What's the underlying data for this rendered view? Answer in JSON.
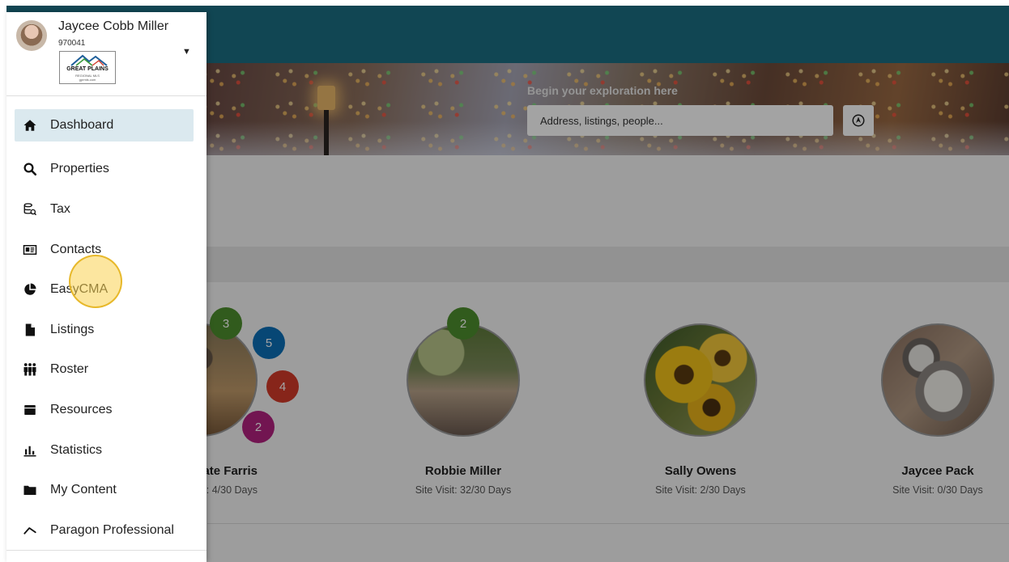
{
  "user": {
    "name": "Jaycee Cobb Miller",
    "id": "970041",
    "logo_brand": "GREAT PLAINS",
    "logo_sub": "REGIONAL MLS",
    "logo_url": "gprmls.com"
  },
  "nav": {
    "items": [
      {
        "label": "Dashboard",
        "icon": "home-icon",
        "active": true
      },
      {
        "label": "Properties",
        "icon": "search-icon"
      },
      {
        "label": "Tax",
        "icon": "tax-database-icon"
      },
      {
        "label": "Contacts",
        "icon": "contact-card-icon"
      },
      {
        "label": "EasyCMA",
        "icon": "pie-chart-icon"
      },
      {
        "label": "Listings",
        "icon": "document-icon"
      },
      {
        "label": "Roster",
        "icon": "people-icon"
      },
      {
        "label": "Resources",
        "icon": "archive-box-icon"
      },
      {
        "label": "Statistics",
        "icon": "bar-chart-icon"
      },
      {
        "label": "My Content",
        "icon": "folder-icon"
      },
      {
        "label": "Paragon Professional",
        "icon": "trend-line-icon"
      }
    ]
  },
  "search": {
    "label": "Begin your exploration here",
    "placeholder": "Address, listings, people..."
  },
  "contacts": [
    {
      "name": "ate Farris",
      "visit": "isit: 4/30 Days"
    },
    {
      "name": "Robbie Miller",
      "visit": "Site Visit: 32/30 Days",
      "badge": "2"
    },
    {
      "name": "Sally Owens",
      "visit": "Site Visit: 2/30 Days"
    },
    {
      "name": "Jaycee Pack",
      "visit": "Site Visit: 0/30 Days"
    }
  ],
  "group_badges": [
    "3",
    "5",
    "4",
    "2"
  ],
  "colors": {
    "header": "#1c6e82",
    "active_nav": "#dbe9ef",
    "badge_green": "#4e8f2e",
    "badge_blue": "#0b6fb8",
    "badge_red": "#d33a2a",
    "badge_magenta": "#b3227f"
  }
}
